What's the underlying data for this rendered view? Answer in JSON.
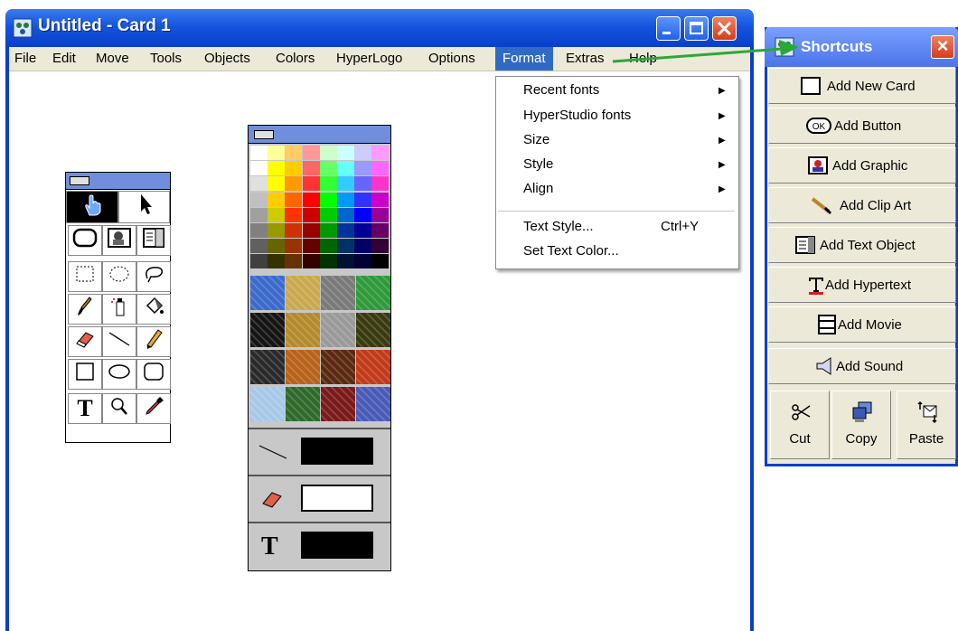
{
  "window": {
    "title": "Untitled - Card 1"
  },
  "menubar": {
    "items": [
      "File",
      "Edit",
      "Move",
      "Tools",
      "Objects",
      "Colors",
      "HyperLogo",
      "Options",
      "Format",
      "Extras",
      "Help"
    ],
    "active": "Format"
  },
  "format_menu": {
    "items": [
      {
        "label": "Recent fonts",
        "submenu": true
      },
      {
        "label": "HyperStudio fonts",
        "submenu": true
      },
      {
        "label": "Size",
        "submenu": true
      },
      {
        "label": "Style",
        "submenu": true
      },
      {
        "label": "Align",
        "submenu": true
      },
      {
        "label": "Text Style...",
        "shortcut": "Ctrl+Y"
      },
      {
        "label": "Set Text Color..."
      }
    ]
  },
  "tools_palette": {
    "tools": [
      "browse-hand-icon",
      "pointer-arrow-icon",
      "button-tool-icon",
      "graphic-tool-icon",
      "text-object-tool-icon",
      "rectangle-select-icon",
      "lasso-oval-select-icon",
      "lasso-icon",
      "paintbrush-icon",
      "spray-can-icon",
      "paint-bucket-icon",
      "eraser-icon",
      "line-icon",
      "pencil-icon",
      "rectangle-icon",
      "oval-icon",
      "rounded-rectangle-icon",
      "text-tool-icon",
      "magnifier-icon",
      "eyedropper-icon"
    ],
    "text_tool_glyph": "T"
  },
  "color_palette": {
    "colors": {
      "row0": [
        "#ffffff",
        "#ffff99",
        "#ffcc66",
        "#ff9999",
        "#ccffcc",
        "#ccffff",
        "#ccccff",
        "#ff99ff"
      ],
      "row1": [
        "#ffffff",
        "#ffff00",
        "#ffcc00",
        "#ff6666",
        "#66ff66",
        "#66ffff",
        "#9999ff",
        "#ff66ff"
      ],
      "row2": [
        "#e0e0e0",
        "#ffff00",
        "#ff9900",
        "#ff3333",
        "#33ff33",
        "#33ccff",
        "#6666ff",
        "#ff33cc"
      ],
      "row3": [
        "#c0c0c0",
        "#ffcc00",
        "#ff6600",
        "#ff0000",
        "#00ff00",
        "#0099ff",
        "#3333ff",
        "#cc00cc"
      ],
      "row4": [
        "#a0a0a0",
        "#cccc00",
        "#ff3300",
        "#cc0000",
        "#00cc00",
        "#0066cc",
        "#0000ff",
        "#990099"
      ],
      "row5": [
        "#808080",
        "#999900",
        "#cc3300",
        "#990000",
        "#009900",
        "#003399",
        "#000099",
        "#660066"
      ],
      "row6": [
        "#606060",
        "#666600",
        "#993300",
        "#660000",
        "#006600",
        "#003366",
        "#000066",
        "#330033"
      ],
      "row7": [
        "#404040",
        "#333300",
        "#663300",
        "#330000",
        "#003300",
        "#001133",
        "#000033",
        "#000000"
      ]
    },
    "patterns": [
      "#3b6acb",
      "#c9a94e",
      "#7a7a7a",
      "#2f9a3a",
      "#151515",
      "#b48a2c",
      "#9a9a9a",
      "#3a3a10",
      "#2a2a2a",
      "#b8621a",
      "#5a2a10",
      "#c23a1a",
      "#a8c8e8",
      "#2f6a2a",
      "#7a1a1a",
      "#4a5ab8"
    ],
    "line_color": "#000000",
    "fill_color": "#ffffff",
    "text_color": "#000000",
    "text_glyph": "T"
  },
  "shortcuts": {
    "title": "Shortcuts",
    "buttons": [
      {
        "label": "Add New Card",
        "icon": "new-card-icon"
      },
      {
        "label": "Add Button",
        "icon": "ok-button-icon",
        "icon_text": "OK"
      },
      {
        "label": "Add Graphic",
        "icon": "graphic-icon"
      },
      {
        "label": "Add Clip Art",
        "icon": "clip-art-icon"
      },
      {
        "label": "Add Text Object",
        "icon": "text-object-icon"
      },
      {
        "label": "Add Hypertext",
        "icon": "hypertext-icon"
      },
      {
        "label": "Add Movie",
        "icon": "movie-icon"
      },
      {
        "label": "Add Sound",
        "icon": "speaker-icon"
      }
    ],
    "small_buttons": [
      {
        "label": "Cut",
        "icon": "scissors-icon"
      },
      {
        "label": "Copy",
        "icon": "copy-icon"
      },
      {
        "label": "Paste",
        "icon": "paste-icon"
      }
    ]
  },
  "annotation": {
    "arrow_color": "#2aa83a"
  }
}
